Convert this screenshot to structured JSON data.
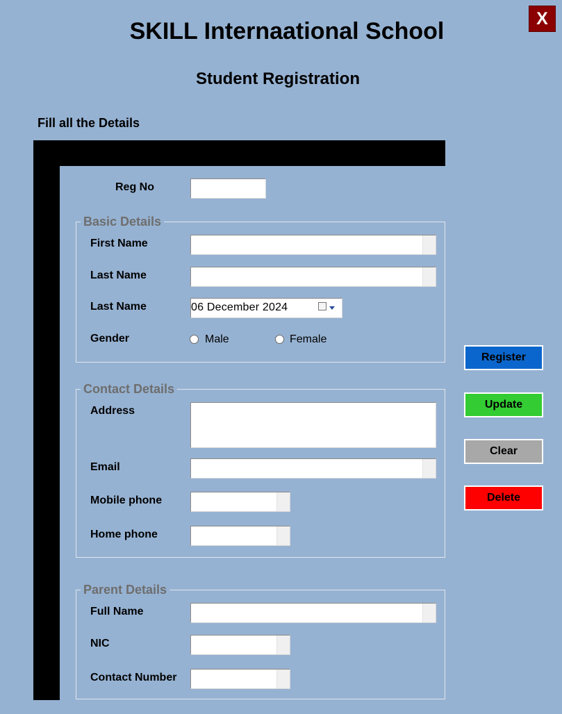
{
  "window": {
    "title": "SKILL Internaational School",
    "subtitle": "Student Registration",
    "close_label": "X"
  },
  "form": {
    "instruction": "Fill all the Details",
    "reg_no": {
      "label": "Reg No",
      "value": ""
    },
    "basic_details": {
      "legend": "Basic Details",
      "first_name": {
        "label": "First Name",
        "value": ""
      },
      "last_name": {
        "label": "Last Name",
        "value": ""
      },
      "date": {
        "label": "Last Name",
        "value": "06  December  2024",
        "icon": "calendar-icon"
      },
      "gender": {
        "label": "Gender",
        "options": [
          "Male",
          "Female"
        ],
        "selected": null
      }
    },
    "contact_details": {
      "legend": "Contact Details",
      "address": {
        "label": "Address",
        "value": ""
      },
      "email": {
        "label": "Email",
        "value": ""
      },
      "mobile_phone": {
        "label": "Mobile phone",
        "value": ""
      },
      "home_phone": {
        "label": "Home phone",
        "value": ""
      }
    },
    "parent_details": {
      "legend": "Parent Details",
      "full_name": {
        "label": "Full Name",
        "value": ""
      },
      "nic": {
        "label": "NIC",
        "value": ""
      },
      "contact_number": {
        "label": "Contact Number",
        "value": ""
      }
    }
  },
  "actions": {
    "register": {
      "label": "Register",
      "color": "#0a66cc"
    },
    "update": {
      "label": "Update",
      "color": "#33cc33"
    },
    "clear": {
      "label": "Clear",
      "color": "#a8a8a8"
    },
    "delete": {
      "label": "Delete",
      "color": "#ff0000"
    }
  },
  "colors": {
    "background": "#96b2d2",
    "frame": "#000000",
    "close_button": "#8b0000",
    "legend_text": "#6e6e6e"
  }
}
